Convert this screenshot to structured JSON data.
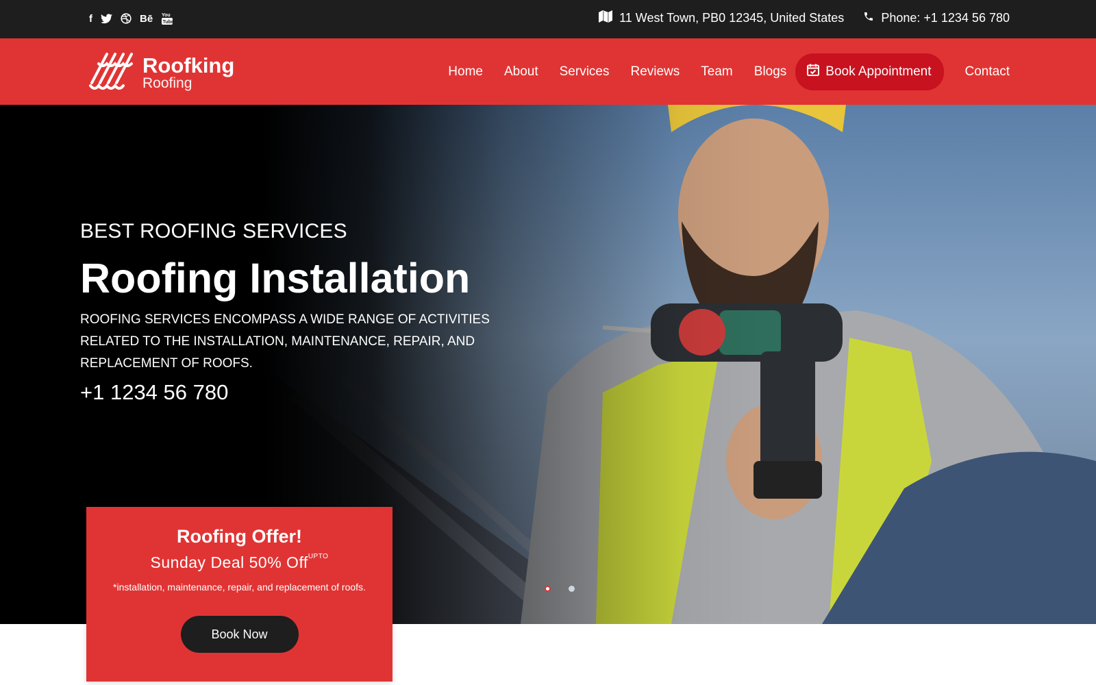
{
  "topbar": {
    "social": [
      {
        "icon": "facebook-icon",
        "glyph": "f"
      },
      {
        "icon": "twitter-icon",
        "glyph": "🐦"
      },
      {
        "icon": "dribbble-icon",
        "glyph": "◍"
      },
      {
        "icon": "behance-icon",
        "glyph": "Bē"
      },
      {
        "icon": "youtube-icon",
        "glyph": "▶"
      }
    ],
    "address": "11 West Town, PB0 12345, United States",
    "address_icon": "map-icon",
    "phone": "Phone: +1 1234 56 780",
    "phone_icon": "phone-icon"
  },
  "brand": {
    "name": "Roofking",
    "tagline": "Roofing",
    "logo_icon": "roof-tiles-logo-icon"
  },
  "nav": {
    "home": "Home",
    "about": "About",
    "services": "Services",
    "reviews": "Reviews",
    "team": "Team",
    "blogs": "Blogs",
    "book": "Book Appointment",
    "book_icon": "calendar-check-icon",
    "contact": "Contact"
  },
  "hero": {
    "kicker": "BEST ROOFING SERVICES",
    "title": "Roofing Installation",
    "description": "ROOFING SERVICES ENCOMPASS A WIDE RANGE OF ACTIVITIES RELATED TO THE INSTALLATION, MAINTENANCE, REPAIR, AND REPLACEMENT OF ROOFS.",
    "phone": "+1 1234 56 780",
    "slides": 2,
    "active_slide": 1
  },
  "offer": {
    "title": "Roofing Offer!",
    "deal": "Sunday Deal 50% Off",
    "deal_sup": "UPTO",
    "note": "*installation, maintenance, repair, and replacement of roofs.",
    "button": "Book Now"
  },
  "colors": {
    "brand_red": "#e03434",
    "button_red": "#c8121f",
    "dark": "#1e1e1e"
  }
}
